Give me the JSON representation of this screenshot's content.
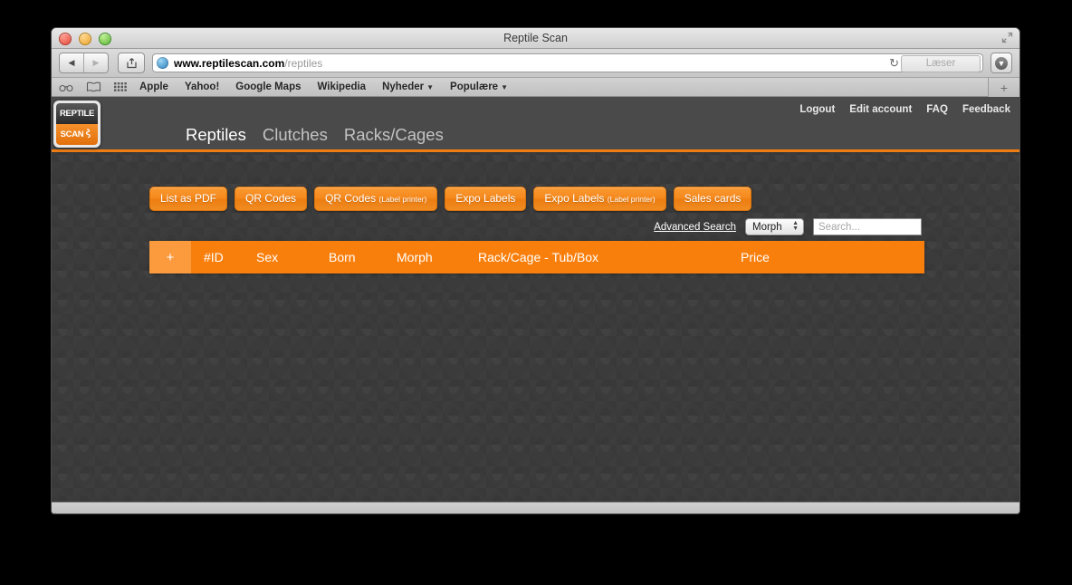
{
  "window": {
    "title": "Reptile Scan",
    "traffic_lights": [
      "close",
      "minimize",
      "zoom"
    ],
    "fullscreen_icon": "fullscreen-icon"
  },
  "toolbar": {
    "back_label": "◀",
    "forward_label": "▶",
    "share_icon": "share-icon",
    "url_domain": "www.reptilescan.com",
    "url_path": "/reptiles",
    "reload_label": "↻",
    "reader_label": "Læser",
    "downloads_icon": "downloads-icon"
  },
  "bookmarks_bar": {
    "icons": [
      "reading-list-icon",
      "bookmarks-icon",
      "top-sites-icon"
    ],
    "items": [
      {
        "label": "Apple",
        "has_caret": false
      },
      {
        "label": "Yahoo!",
        "has_caret": false
      },
      {
        "label": "Google Maps",
        "has_caret": false
      },
      {
        "label": "Wikipedia",
        "has_caret": false
      },
      {
        "label": "Nyheder",
        "has_caret": true
      },
      {
        "label": "Populære",
        "has_caret": true
      }
    ],
    "new_tab_label": "+"
  },
  "site": {
    "logo": {
      "top_text": "REPTILE",
      "bottom_text": "SCAN",
      "snake_glyph": "⌁"
    },
    "main_nav": [
      {
        "label": "Reptiles",
        "active": true
      },
      {
        "label": "Clutches",
        "active": false
      },
      {
        "label": "Racks/Cages",
        "active": false
      }
    ],
    "util_nav": [
      {
        "label": "Logout"
      },
      {
        "label": "Edit account"
      },
      {
        "label": "FAQ"
      },
      {
        "label": "Feedback"
      }
    ],
    "accent_color": "#f97f0c",
    "header_bg": "#4a4a4a",
    "page_bg": "#3b3b3b"
  },
  "actions": [
    {
      "label": "List as PDF",
      "sub": ""
    },
    {
      "label": "QR Codes",
      "sub": ""
    },
    {
      "label": "QR Codes",
      "sub": "(Label printer)"
    },
    {
      "label": "Expo Labels",
      "sub": ""
    },
    {
      "label": "Expo Labels",
      "sub": "(Label printer)"
    },
    {
      "label": "Sales cards",
      "sub": ""
    }
  ],
  "search": {
    "advanced_label": "Advanced Search",
    "filter_selected": "Morph",
    "input_placeholder": "Search...",
    "input_value": ""
  },
  "table": {
    "add_label": "+",
    "columns": [
      "#ID",
      "Sex",
      "Born",
      "Morph",
      "Rack/Cage - Tub/Box",
      "Price"
    ],
    "rows": []
  }
}
